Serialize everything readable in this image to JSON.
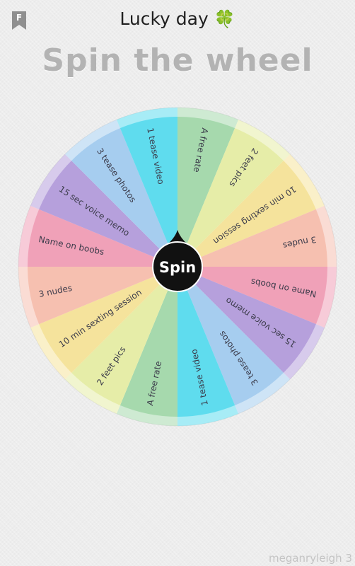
{
  "header": {
    "title": "Lucky day",
    "clover_glyph": "🍀",
    "app_icon": "bookmark-icon"
  },
  "heading": "Spin the wheel",
  "wheel": {
    "spin_label": "Spin",
    "colors": {
      "pointer": "#111111",
      "spin_text": "#ffffff",
      "label_text": "#3b3b4a"
    },
    "segments": [
      {
        "label": "A free rate",
        "color": "#a6d9ad"
      },
      {
        "label": "2 feet pics",
        "color": "#e6eda8"
      },
      {
        "label": "10 min sexting session",
        "color": "#f5e39c"
      },
      {
        "label": "3 nudes",
        "color": "#f6c0b0"
      },
      {
        "label": "Name on boobs",
        "color": "#f0a1b8"
      },
      {
        "label": "15 sec voice memo",
        "color": "#b6a0dc"
      },
      {
        "label": "3 tease photos",
        "color": "#a6cdef"
      },
      {
        "label": "1 tease video",
        "color": "#5fdcee"
      },
      {
        "label": "A free rate",
        "color": "#a6d9ad"
      },
      {
        "label": "2 feet pics",
        "color": "#e6eda8"
      },
      {
        "label": "10 min sexting session",
        "color": "#f5e39c"
      },
      {
        "label": "3 nudes",
        "color": "#f6c0b0"
      },
      {
        "label": "Name on boobs",
        "color": "#f0a1b8"
      },
      {
        "label": "15 sec voice memo",
        "color": "#b6a0dc"
      },
      {
        "label": "3 tease photos",
        "color": "#a6cdef"
      },
      {
        "label": "1 tease video",
        "color": "#5fdcee"
      }
    ]
  },
  "watermark": "meganryleigh 3"
}
